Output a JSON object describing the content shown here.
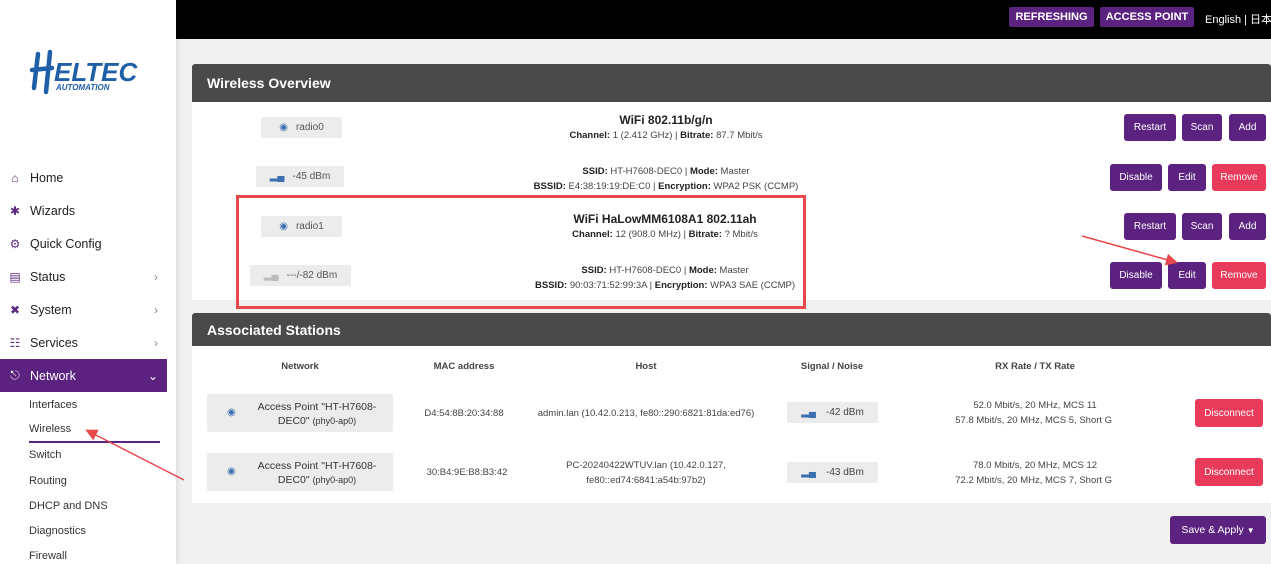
{
  "brand": {
    "logo_text": "HELTEC",
    "logo_sub": "AUTOMATION"
  },
  "topbar": {
    "refreshing": "REFRESHING",
    "access_point": "ACCESS POINT",
    "language": "English | 日本語"
  },
  "menu": [
    {
      "label": "Home",
      "icon": "home-icon"
    },
    {
      "label": "Wizards",
      "icon": "wand-icon"
    },
    {
      "label": "Quick Config",
      "icon": "gear-icon"
    },
    {
      "label": "Status",
      "icon": "clipboard-icon"
    },
    {
      "label": "System",
      "icon": "tools-icon"
    },
    {
      "label": "Services",
      "icon": "services-icon"
    },
    {
      "label": "Network",
      "icon": "network-icon"
    }
  ],
  "submenu": [
    "Interfaces",
    "Wireless",
    "Switch",
    "Routing",
    "DHCP and DNS",
    "Diagnostics",
    "Firewall"
  ],
  "wireless": {
    "title": "Wireless Overview",
    "radio0": {
      "name": "radio0",
      "heading": "WiFi 802.11b/g/n",
      "channel_label": "Channel:",
      "channel": "1 (2.412 GHz)",
      "bitrate_label": "Bitrate:",
      "bitrate": "87.7 Mbit/s",
      "signal": "-45 dBm",
      "ssid_label": "SSID:",
      "ssid": "HT-H7608-DEC0",
      "mode_label": "Mode:",
      "mode": "Master",
      "bssid_label": "BSSID:",
      "bssid": "E4:38:19:19:DE:C0",
      "enc_label": "Encryption:",
      "encryption": "WPA2 PSK (CCMP)"
    },
    "radio1": {
      "name": "radio1",
      "heading": "WiFi HaLowMM6108A1 802.11ah",
      "channel_label": "Channel:",
      "channel": "12 (908.0 MHz)",
      "bitrate_label": "Bitrate:",
      "bitrate": "? Mbit/s",
      "signal": "---/-82 dBm",
      "ssid_label": "SSID:",
      "ssid": "HT-H7608-DEC0",
      "mode_label": "Mode:",
      "mode": "Master",
      "bssid_label": "BSSID:",
      "bssid": "90:03:71:52:99:3A",
      "enc_label": "Encryption:",
      "encryption": "WPA3 SAE (CCMP)"
    },
    "buttons": {
      "restart": "Restart",
      "scan": "Scan",
      "add": "Add",
      "disable": "Disable",
      "edit": "Edit",
      "remove": "Remove"
    }
  },
  "stations": {
    "title": "Associated Stations",
    "headers": [
      "Network",
      "MAC address",
      "Host",
      "Signal / Noise",
      "RX Rate / TX Rate"
    ],
    "rows": [
      {
        "network_l1": "Access Point \"HT-H7608-",
        "network_l2": "DEC0\"",
        "network_iface": "(phy0-ap0)",
        "mac": "D4:54:8B:20:34:88",
        "host_l1": "admin.lan (10.42.0.213, fe80::290:6821:81da:ed76)",
        "host_l2": "",
        "signal": "-42 dBm",
        "rx": "52.0 Mbit/s, 20 MHz, MCS 11",
        "tx": "57.8 Mbit/s, 20 MHz, MCS 5, Short GI",
        "action": "Disconnect"
      },
      {
        "network_l1": "Access Point \"HT-H7608-",
        "network_l2": "DEC0\"",
        "network_iface": "(phy0-ap0)",
        "mac": "30:B4:9E:B8:B3:42",
        "host_l1": "PC-20240422WTUV.lan (10.42.0.127,",
        "host_l2": "fe80::ed74:6841:a54b:97b2)",
        "signal": "-43 dBm",
        "rx": "78.0 Mbit/s, 20 MHz, MCS 12",
        "tx": "72.2 Mbit/s, 20 MHz, MCS 7, Short GI",
        "action": "Disconnect"
      }
    ]
  },
  "save_apply": "Save & Apply",
  "colors": {
    "accent": "#5b2280",
    "danger": "#e83a5a",
    "annotation": "#e8474c"
  }
}
